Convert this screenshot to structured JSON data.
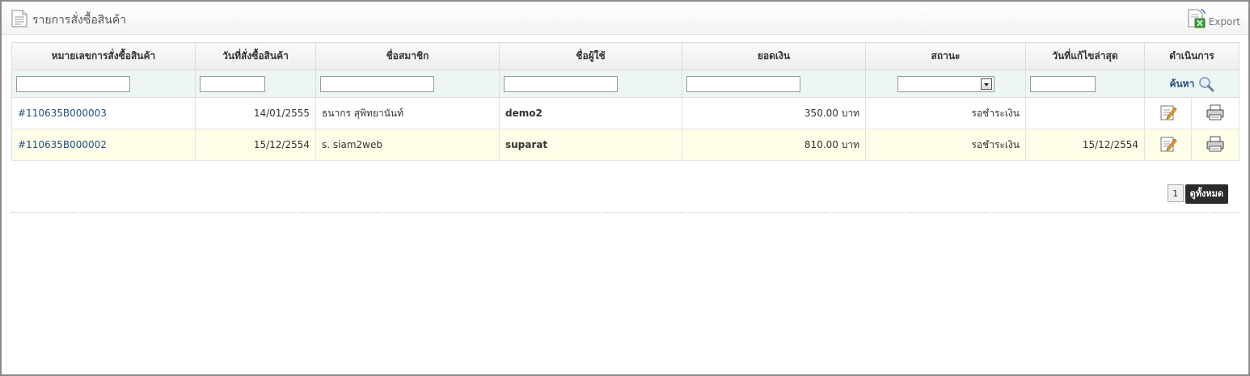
{
  "page": {
    "title": "รายการสั่งซื้อสินค้า",
    "export_label": "Export"
  },
  "columns": [
    "หมายเลขการสั่งซื้อสินค้า",
    "วันที่สั่งซื้อสินค้า",
    "ชื่อสมาชิก",
    "ชื่อผู้ใช้",
    "ยอดเงิน",
    "สถานะ",
    "วันที่แก้ไขล่าสุด",
    "ดำเนินการ"
  ],
  "filters": {
    "order_no": "",
    "order_date": "",
    "member_name": "",
    "username": "",
    "amount": "",
    "status": "",
    "last_modified": "",
    "search_label": "ค้นหา"
  },
  "rows": [
    {
      "order_no": "#110635B000003",
      "order_date": "14/01/2555",
      "member_name": "ธนากร สุพิทยานันท์",
      "username": "demo2",
      "amount": "350.00 บาท",
      "status": "รอชำระเงิน",
      "last_modified": ""
    },
    {
      "order_no": "#110635B000002",
      "order_date": "15/12/2554",
      "member_name": "s. siam2web",
      "username": "suparat",
      "amount": "810.00 บาท",
      "status": "รอชำระเงิน",
      "last_modified": "15/12/2554"
    }
  ],
  "pager": {
    "current_page": "1",
    "view_all_label": "ดูทั้งหมด"
  },
  "colors": {
    "link": "#234e86",
    "alt_row": "#fdfde8",
    "filter_row": "#eef5f5"
  }
}
